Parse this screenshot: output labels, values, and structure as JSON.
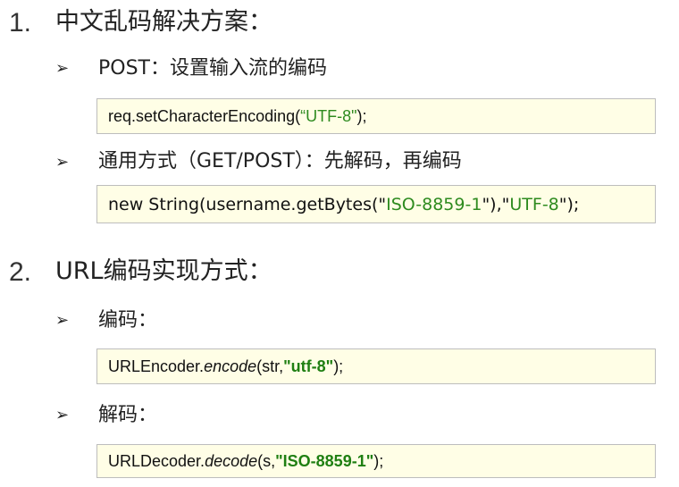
{
  "section1": {
    "number": "1.",
    "title": "中文乱码解决方案：",
    "items": [
      {
        "bullet": "➢",
        "label": "POST：设置输入流的编码",
        "code": {
          "prefix": "req.setCharacterEncoding(",
          "string": "“UTF-8\"",
          "suffix": ");"
        }
      },
      {
        "bullet": "➢",
        "label": "通用方式（GET/POST）：先解码，再编码",
        "code": {
          "prefix": "new String(username.getBytes(\"",
          "string1": "ISO-8859-1",
          "middle": "\"),\"",
          "string2": "UTF-8",
          "suffix": "\");"
        }
      }
    ]
  },
  "section2": {
    "number": "2.",
    "title": "URL编码实现方式：",
    "items": [
      {
        "bullet": "➢",
        "label": "编码：",
        "code": {
          "class_name": "URLEncoder.",
          "method": "encode",
          "args_prefix": "(str, ",
          "string": "\"utf-8\"",
          "suffix": ");"
        }
      },
      {
        "bullet": "➢",
        "label": "解码：",
        "code": {
          "class_name": "URLDecoder.",
          "method": "decode",
          "args_prefix": "(s, ",
          "string": "\"ISO-8859-1\"",
          "suffix": ");"
        }
      }
    ]
  }
}
